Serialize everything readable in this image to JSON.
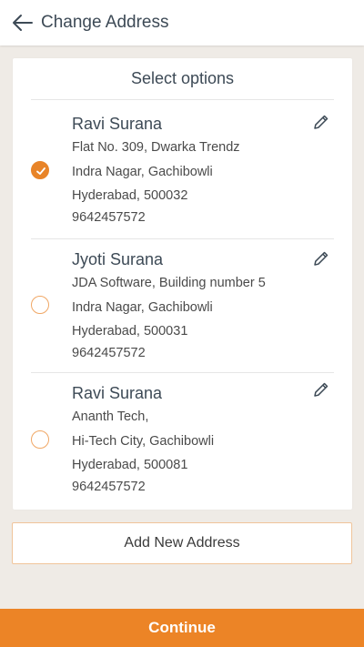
{
  "header": {
    "title": "Change Address",
    "back_icon": "arrow-left-icon"
  },
  "card": {
    "title": "Select options"
  },
  "addresses": [
    {
      "name": "Ravi Surana",
      "line1": "Flat No. 309, Dwarka Trendz",
      "line2": "Indra Nagar, Gachibowli",
      "line3": "Hyderabad, 500032",
      "phone": "9642457572",
      "selected": true
    },
    {
      "name": "Jyoti Surana",
      "line1": "JDA Software, Building number 5",
      "line2": "Indra Nagar, Gachibowli",
      "line3": "Hyderabad, 500031",
      "phone": "9642457572",
      "selected": false
    },
    {
      "name": "Ravi Surana",
      "line1": "Ananth Tech,",
      "line2": "Hi-Tech City, Gachibowli",
      "line3": "Hyderabad, 500081",
      "phone": "9642457572",
      "selected": false
    }
  ],
  "add_address_label": "Add New Address",
  "continue_label": "Continue",
  "colors": {
    "accent": "#ec8426",
    "background": "#efebe6",
    "text_dark": "#3d4a56"
  }
}
